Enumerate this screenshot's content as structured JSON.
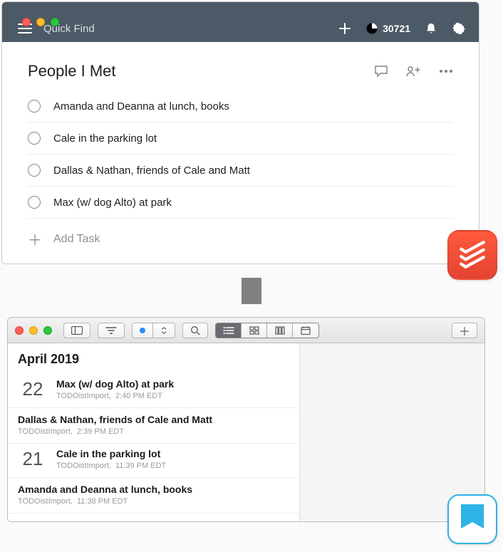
{
  "todoist": {
    "quick_find_placeholder": "Quick Find",
    "karma": "30721",
    "project_title": "People I Met",
    "tasks": [
      "Amanda and Deanna at lunch, books",
      "Cale in the parking lot",
      "Dallas & Nathan, friends of Cale and Matt",
      "Max (w/ dog Alto) at park"
    ],
    "add_task_label": "Add Task"
  },
  "journal": {
    "month_title": "April 2019",
    "entries": [
      {
        "day": "22",
        "title": "Max (w/ dog Alto) at park",
        "source": "TODOistImport",
        "time": "2:40 PM EDT",
        "show_day": true
      },
      {
        "day": "",
        "title": "Dallas & Nathan, friends of Cale and Matt",
        "source": "TODOistImport",
        "time": "2:39 PM EDT",
        "show_day": false
      },
      {
        "day": "21",
        "title": "Cale in the parking lot",
        "source": "TODOistImport",
        "time": "11:39 PM EDT",
        "show_day": true
      },
      {
        "day": "",
        "title": "Amanda and Deanna at lunch, books",
        "source": "TODOistImport",
        "time": "11:38 PM EDT",
        "show_day": false
      }
    ]
  }
}
